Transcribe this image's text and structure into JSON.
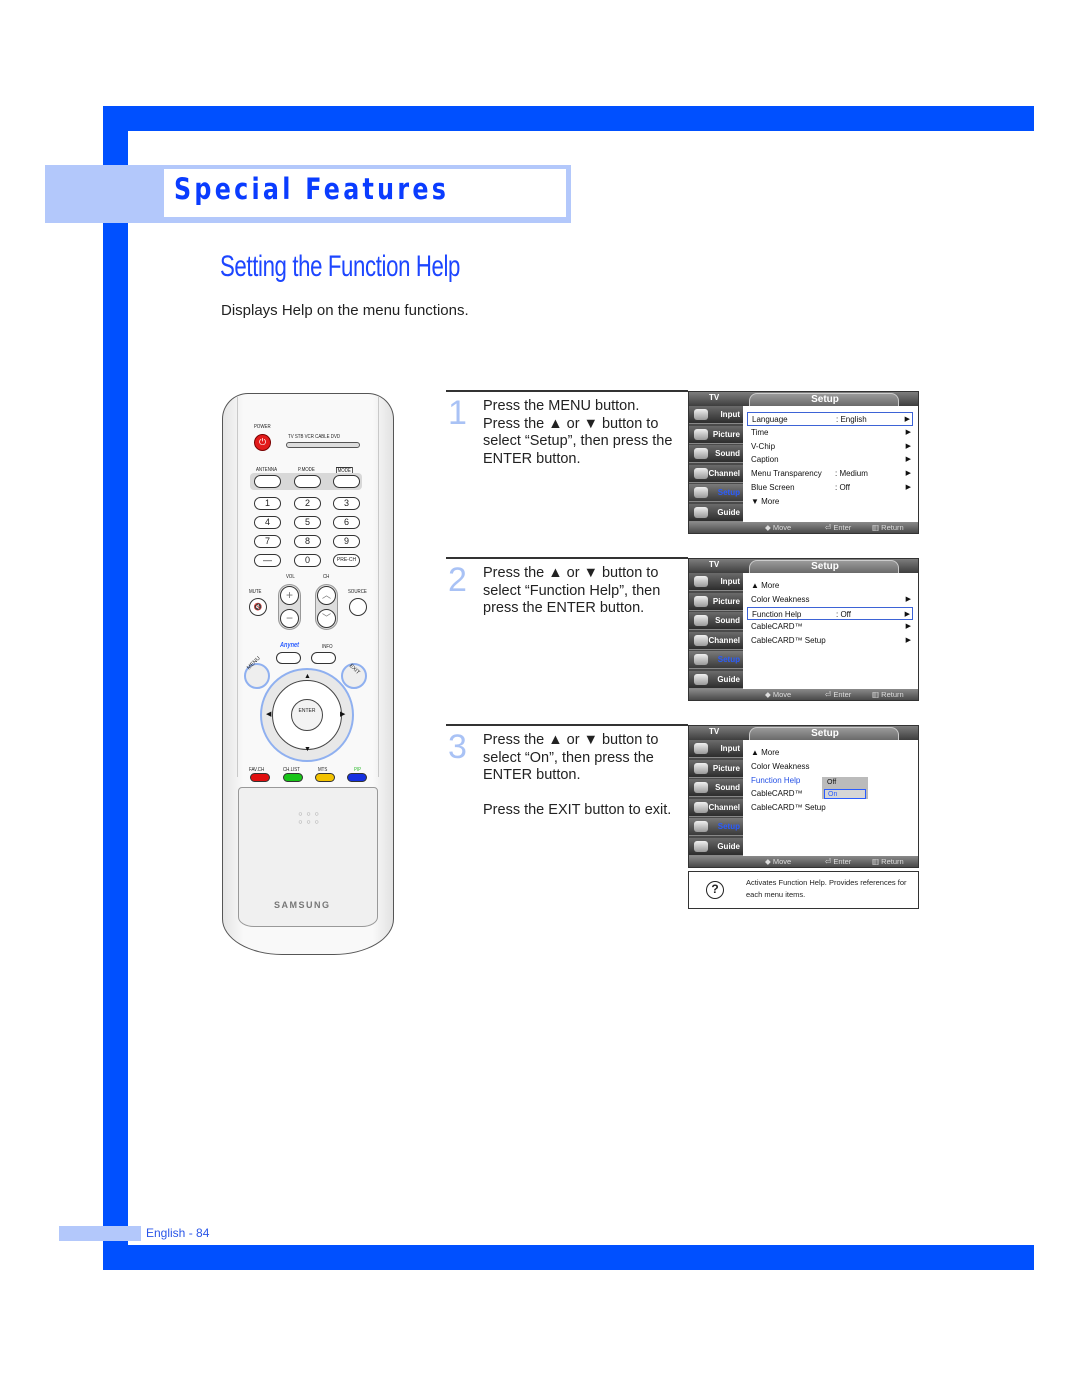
{
  "header": {
    "section_title": "Special Features",
    "page_title": "Setting the Function Help",
    "description": "Displays Help on the menu functions."
  },
  "colors": {
    "frame_blue": "#0050ff",
    "band_light_blue": "#b3c8fb",
    "title_blue": "#1d46ff",
    "step_number": "#a9c2f5",
    "osd_highlight": "#2a5cff"
  },
  "remote": {
    "labels": {
      "power": "POWER",
      "modes": "TV  STB  VCR  CABLE  DVD",
      "antenna": "ANTENNA",
      "pmode": "P.MODE",
      "mode": "MODE",
      "vol": "VOL",
      "ch": "CH",
      "mute": "MUTE",
      "source": "SOURCE",
      "anynet": "Anynet",
      "info": "INFO",
      "menu": "MENU",
      "exit": "EXIT",
      "enter": "ENTER",
      "favch": "FAV.CH",
      "chlist": "CH.LIST",
      "mts": "MTS",
      "pip": "PIP",
      "brand": "SAMSUNG"
    },
    "keys": [
      "1",
      "2",
      "3",
      "4",
      "5",
      "6",
      "7",
      "8",
      "9",
      "—",
      "0",
      "PRE-CH"
    ],
    "icons": {
      "power": "⏻",
      "vol_up": "+",
      "vol_down": "−",
      "ch_up": "︿",
      "ch_down": "﹀",
      "mute": "🔇",
      "up": "▲",
      "down": "▼",
      "left": "◀",
      "right": "▶",
      "mic": "○ ○ ○\n○ ○ ○"
    }
  },
  "steps": [
    {
      "number": "1",
      "text": "Press the MENU button.\nPress the ▲ or ▼ button to select “Setup”, then press the ENTER button."
    },
    {
      "number": "2",
      "text": "Press the ▲ or ▼ button to select “Function Help”, then press the ENTER button."
    },
    {
      "number": "3",
      "text": "Press the ▲ or ▼ button to select “On”, then press the ENTER button.\n\nPress the EXIT button to exit."
    }
  ],
  "osd_common": {
    "tv_label": "TV",
    "title": "Setup",
    "tabs": [
      "Input",
      "Picture",
      "Sound",
      "Channel",
      "Setup",
      "Guide"
    ],
    "footer": {
      "move": "◆ Move",
      "enter": "⏎ Enter",
      "return": "▥ Return"
    }
  },
  "osd_screens": [
    {
      "rows": [
        {
          "label": "Language",
          "value": ": English",
          "arrow": "▶"
        },
        {
          "label": "Time",
          "value": "",
          "arrow": "▶"
        },
        {
          "label": "V-Chip",
          "value": "",
          "arrow": "▶"
        },
        {
          "label": "Caption",
          "value": "",
          "arrow": "▶"
        },
        {
          "label": "Menu Transparency",
          "value": ": Medium",
          "arrow": "▶"
        },
        {
          "label": "Blue Screen",
          "value": ": Off",
          "arrow": "▶"
        },
        {
          "label": "▼ More",
          "value": "",
          "arrow": ""
        }
      ],
      "selected_row": 0
    },
    {
      "rows": [
        {
          "label": "▲ More",
          "value": "",
          "arrow": ""
        },
        {
          "label": "Color Weakness",
          "value": "",
          "arrow": "▶"
        },
        {
          "label": "Function Help",
          "value": ": Off",
          "arrow": "▶"
        },
        {
          "label": "CableCARD™",
          "value": "",
          "arrow": "▶"
        },
        {
          "label": "CableCARD™ Setup",
          "value": "",
          "arrow": "▶"
        }
      ],
      "selected_row": 2
    },
    {
      "rows": [
        {
          "label": "▲ More",
          "value": "",
          "arrow": ""
        },
        {
          "label": "Color Weakness",
          "value": "",
          "arrow": ""
        },
        {
          "label": "Function Help",
          "value": "",
          "arrow": ""
        },
        {
          "label": "CableCARD™",
          "value": "",
          "arrow": ""
        },
        {
          "label": "CableCARD™ Setup",
          "value": "",
          "arrow": ""
        }
      ],
      "highlight_row": 2,
      "popup": {
        "options": [
          "Off",
          "On"
        ],
        "selected": "On"
      }
    }
  ],
  "help_box": {
    "icon": "?",
    "text": "Activates Function Help. Provides references for each menu items."
  },
  "footer": {
    "page_label": "English - 84"
  }
}
